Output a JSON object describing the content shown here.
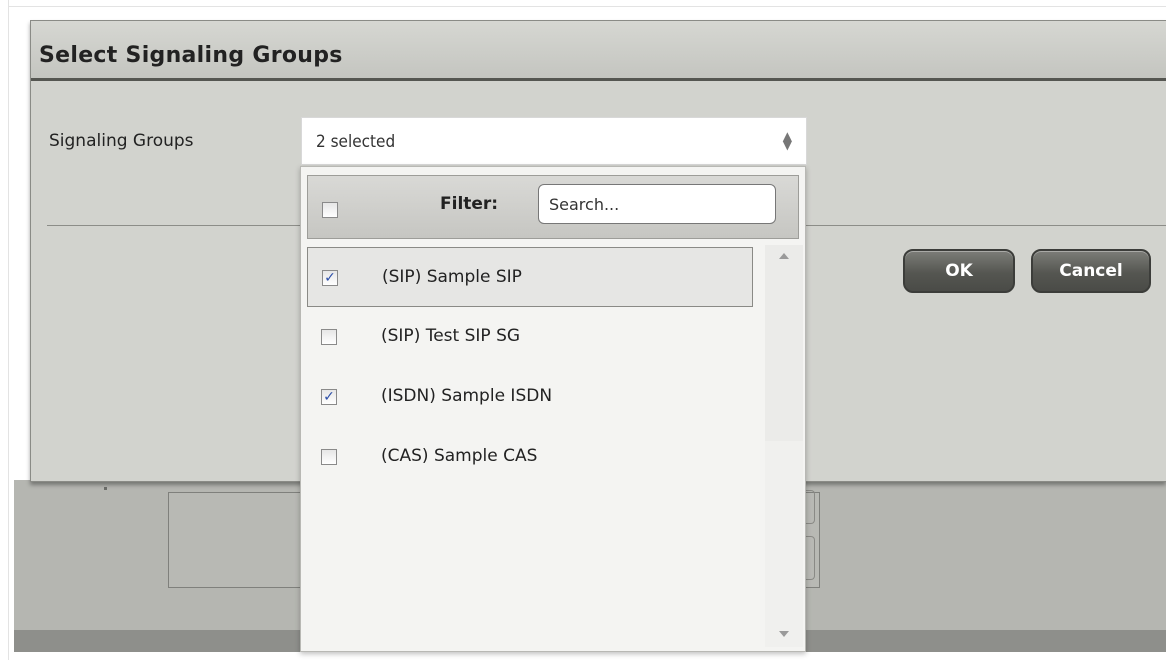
{
  "dialog": {
    "title": "Select Signaling Groups",
    "field_label": "Signaling Groups",
    "select_value": "2 selected",
    "ok_label": "OK",
    "cancel_label": "Cancel"
  },
  "dropdown": {
    "filter_label": "Filter:",
    "filter_placeholder": "Search...",
    "select_all_checked": false,
    "items": [
      {
        "label": "(SIP) Sample SIP",
        "checked": true,
        "highlighted": true
      },
      {
        "label": "(SIP) Test SIP SG",
        "checked": false,
        "highlighted": false
      },
      {
        "label": "(ISDN) Sample ISDN",
        "checked": true,
        "highlighted": false
      },
      {
        "label": "(CAS) Sample CAS",
        "checked": false,
        "highlighted": false
      }
    ]
  },
  "icons": {
    "select_arrows": "up-down-arrows-icon",
    "checkmark": "checkmark-icon",
    "scroll_up": "scroll-up-arrow-icon",
    "scroll_down": "scroll-down-arrow-icon"
  },
  "colors": {
    "dialog_bg": "#d2d3ce",
    "title_underline": "#555651",
    "button": "#555651",
    "checkmark": "#2d4fa8"
  }
}
